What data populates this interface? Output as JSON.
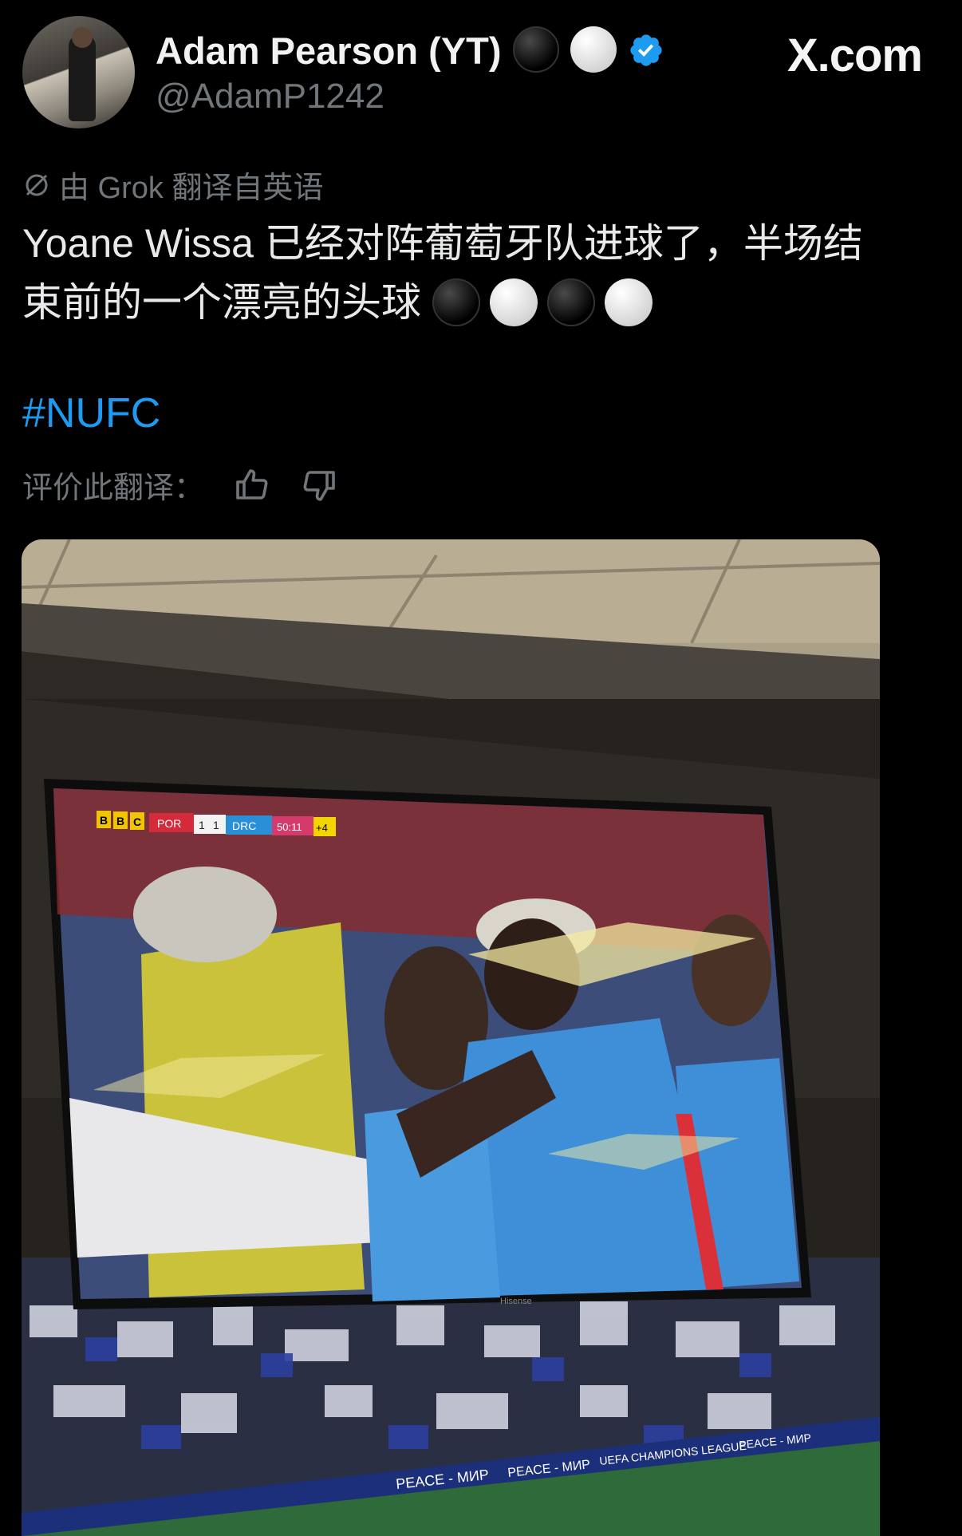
{
  "post": {
    "author_name": "Adam Pearson (YT)",
    "handle": "@AdamP1242",
    "site": "X.com",
    "translation_note": "由 Grok 翻译自英语",
    "text_line1": "Yoane Wissa 已经对阵葡萄牙队进球了，半场结",
    "text_line2": "束前的一个漂亮的头球",
    "hashtag": "#NUFC",
    "rate_label": "评价此翻译："
  },
  "media": {
    "scorebug": {
      "broadcaster": [
        "B",
        "B",
        "C"
      ],
      "home_team": "POR",
      "home_score": "1",
      "away_score": "1",
      "away_team": "DRC",
      "clock": "50:11",
      "added_time": "+4"
    },
    "tv_brand": "Hisense",
    "board_text_1": "PEACE - МИР",
    "board_text_2": "PEACE - МИР",
    "board_text_3": "UEFA CHAMPIONS LEAGUE",
    "board_text_4": "PEACE - МИР"
  },
  "colors": {
    "background": "#000000",
    "text": "#e7e9ea",
    "muted": "#71767b",
    "link": "#1d9bf0",
    "verified": "#1d9bf0"
  },
  "icons": [
    "verified-badge-icon",
    "grok-slash-icon",
    "thumbs-up-icon",
    "thumbs-down-icon"
  ]
}
